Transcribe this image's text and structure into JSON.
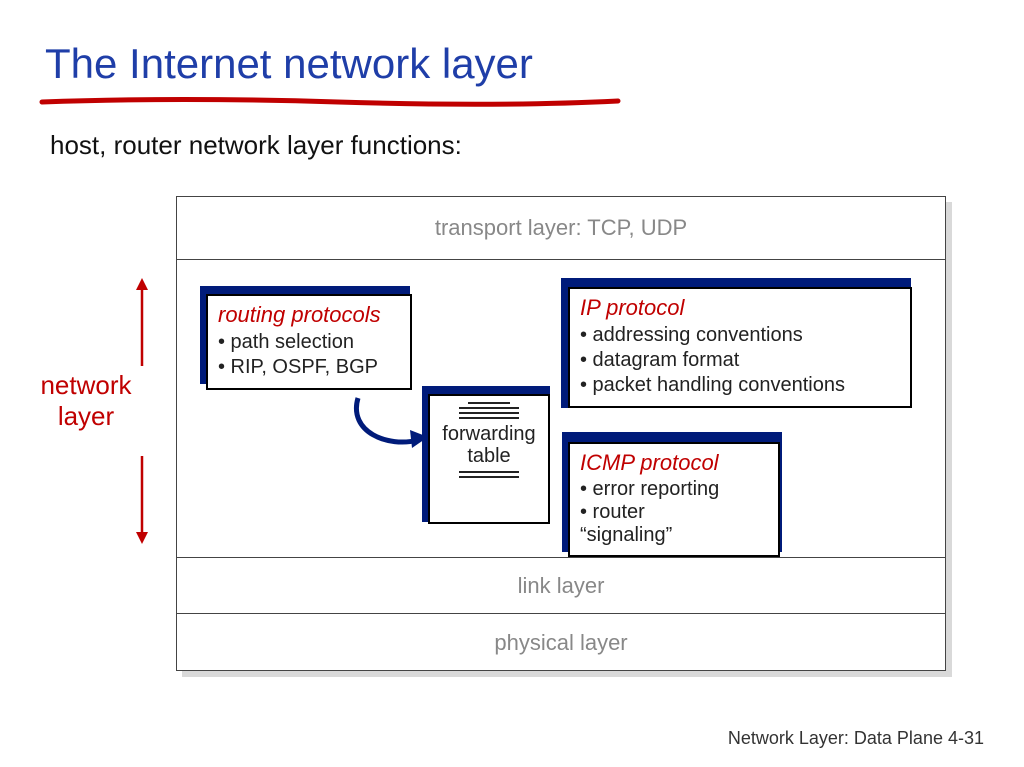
{
  "title": "The Internet network layer",
  "subtitle": "host, router network layer functions:",
  "side_label": "network\nlayer",
  "layers": {
    "transport": "transport layer: TCP, UDP",
    "link": "link layer",
    "physical": "physical layer"
  },
  "boxes": {
    "routing": {
      "title": "routing protocols",
      "lines": [
        "• path selection",
        "• RIP, OSPF, BGP"
      ]
    },
    "ip": {
      "title": "IP protocol",
      "lines": [
        "• addressing conventions",
        "• datagram format",
        "• packet handling conventions"
      ]
    },
    "icmp": {
      "title": "ICMP protocol",
      "lines": [
        "• error reporting",
        "• router",
        "“signaling”"
      ]
    },
    "forwarding": {
      "label": "forwarding\ntable"
    }
  },
  "footer": {
    "text": "Network Layer: Data Plane  4-",
    "page": "31"
  }
}
